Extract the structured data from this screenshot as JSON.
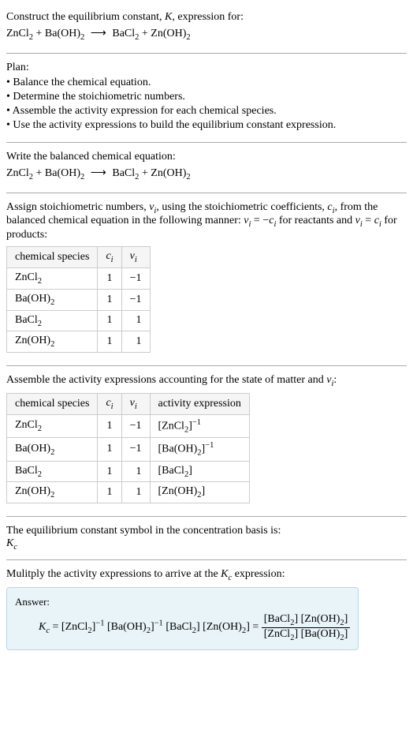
{
  "header": {
    "title_prefix": "Construct the equilibrium constant, ",
    "title_k": "K",
    "title_suffix": ", expression for:",
    "equation_html": "ZnCl<span class=\"sub\">2</span> + Ba(OH)<span class=\"sub\">2</span> <span class=\"arrow\">⟶</span> BaCl<span class=\"sub\">2</span> + Zn(OH)<span class=\"sub\">2</span>"
  },
  "plan": {
    "heading": "Plan:",
    "items": [
      "• Balance the chemical equation.",
      "• Determine the stoichiometric numbers.",
      "• Assemble the activity expression for each chemical species.",
      "• Use the activity expressions to build the equilibrium constant expression."
    ]
  },
  "balanced": {
    "heading": "Write the balanced chemical equation:",
    "equation_html": "ZnCl<span class=\"sub\">2</span> + Ba(OH)<span class=\"sub\">2</span> <span class=\"arrow\">⟶</span> BaCl<span class=\"sub\">2</span> + Zn(OH)<span class=\"sub\">2</span>"
  },
  "assign": {
    "text_html": "Assign stoichiometric numbers, <span class=\"italic\">ν<span class=\"sub\">i</span></span>, using the stoichiometric coefficients, <span class=\"italic\">c<span class=\"sub\">i</span></span>, from the balanced chemical equation in the following manner: <span class=\"italic\">ν<span class=\"sub\">i</span></span> = −<span class=\"italic\">c<span class=\"sub\">i</span></span> for reactants and <span class=\"italic\">ν<span class=\"sub\">i</span></span> = <span class=\"italic\">c<span class=\"sub\">i</span></span> for products:",
    "table": {
      "headers": [
        "chemical species",
        "c_i",
        "ν_i"
      ],
      "header_html": [
        "chemical species",
        "<span class=\"italic\">c<span class=\"sub\">i</span></span>",
        "<span class=\"italic\">ν<span class=\"sub\">i</span></span>"
      ],
      "rows": [
        {
          "species_html": "ZnCl<span class=\"sub\">2</span>",
          "ci": "1",
          "vi": "−1"
        },
        {
          "species_html": "Ba(OH)<span class=\"sub\">2</span>",
          "ci": "1",
          "vi": "−1"
        },
        {
          "species_html": "BaCl<span class=\"sub\">2</span>",
          "ci": "1",
          "vi": "1"
        },
        {
          "species_html": "Zn(OH)<span class=\"sub\">2</span>",
          "ci": "1",
          "vi": "1"
        }
      ]
    }
  },
  "activity": {
    "text_html": "Assemble the activity expressions accounting for the state of matter and <span class=\"italic\">ν<span class=\"sub\">i</span></span>:",
    "table": {
      "headers": [
        "chemical species",
        "c_i",
        "ν_i",
        "activity expression"
      ],
      "header_html": [
        "chemical species",
        "<span class=\"italic\">c<span class=\"sub\">i</span></span>",
        "<span class=\"italic\">ν<span class=\"sub\">i</span></span>",
        "activity expression"
      ],
      "rows": [
        {
          "species_html": "ZnCl<span class=\"sub\">2</span>",
          "ci": "1",
          "vi": "−1",
          "activity_html": "[ZnCl<span class=\"sub\">2</span>]<span class=\"sup\">−1</span>"
        },
        {
          "species_html": "Ba(OH)<span class=\"sub\">2</span>",
          "ci": "1",
          "vi": "−1",
          "activity_html": "[Ba(OH)<span class=\"sub\">2</span>]<span class=\"sup\">−1</span>"
        },
        {
          "species_html": "BaCl<span class=\"sub\">2</span>",
          "ci": "1",
          "vi": "1",
          "activity_html": "[BaCl<span class=\"sub\">2</span>]"
        },
        {
          "species_html": "Zn(OH)<span class=\"sub\">2</span>",
          "ci": "1",
          "vi": "1",
          "activity_html": "[Zn(OH)<span class=\"sub\">2</span>]"
        }
      ]
    }
  },
  "symbol": {
    "text": "The equilibrium constant symbol in the concentration basis is:",
    "kc_html": "<span class=\"italic\">K<span class=\"sub\">c</span></span>"
  },
  "multiply": {
    "text_html": "Mulitply the activity expressions to arrive at the <span class=\"italic\">K<span class=\"sub\">c</span></span> expression:"
  },
  "answer": {
    "label": "Answer:",
    "lhs_html": "<span class=\"italic\">K<span class=\"sub\">c</span></span> = [ZnCl<span class=\"sub\">2</span>]<span class=\"sup\">−1</span> [Ba(OH)<span class=\"sub\">2</span>]<span class=\"sup\">−1</span> [BaCl<span class=\"sub\">2</span>] [Zn(OH)<span class=\"sub\">2</span>] = ",
    "fraction_num_html": "[BaCl<span class=\"sub\">2</span>] [Zn(OH)<span class=\"sub\">2</span>]",
    "fraction_den_html": "[ZnCl<span class=\"sub\">2</span>] [Ba(OH)<span class=\"sub\">2</span>]"
  }
}
